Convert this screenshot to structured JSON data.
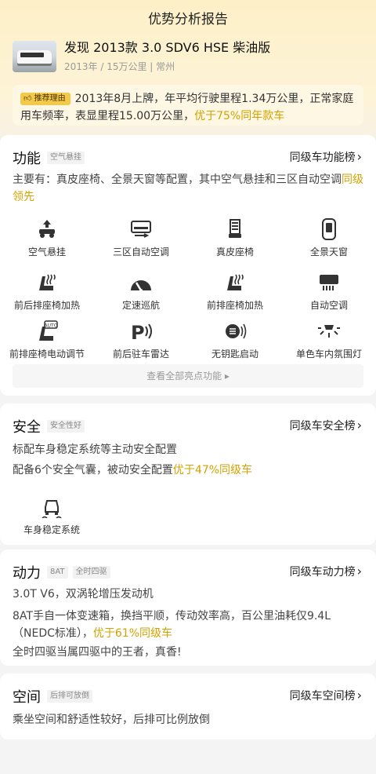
{
  "page": {
    "title": "优势分析报告"
  },
  "car": {
    "name": "发现 2013款 3.0 SDV6 HSE 柴油版",
    "meta": "2013年 / 15万公里 | 常州"
  },
  "reason": {
    "tag": "推荐理由",
    "text": "2013年8月上牌，年平均行驶里程1.34万公里，正常家庭用车频率，表显里程15.00万公里，",
    "highlight": "优于75%同年款车"
  },
  "function": {
    "title": "功能",
    "chip": "空气悬挂",
    "rank_label": "同级车功能榜",
    "desc": "主要有：真皮座椅、全景天窗等配置，其中空气悬挂和三区自动空调",
    "desc_highlight": "同级领先",
    "features": [
      {
        "icon": "air-suspension-icon",
        "label": "空气悬挂"
      },
      {
        "icon": "climate-control-icon",
        "label": "三区自动空调"
      },
      {
        "icon": "leather-seat-icon",
        "label": "真皮座椅"
      },
      {
        "icon": "panoramic-roof-icon",
        "label": "全景天窗"
      },
      {
        "icon": "seat-heating-icon",
        "label": "前后排座椅加热"
      },
      {
        "icon": "cruise-control-icon",
        "label": "定速巡航"
      },
      {
        "icon": "seat-heating-icon",
        "label": "前排座椅加热"
      },
      {
        "icon": "auto-ac-icon",
        "label": "自动空调"
      },
      {
        "icon": "power-seat-icon",
        "label": "前排座椅电动调节"
      },
      {
        "icon": "parking-radar-icon",
        "label": "前后驻车雷达"
      },
      {
        "icon": "keyless-start-icon",
        "label": "无钥匙启动"
      },
      {
        "icon": "ambient-light-icon",
        "label": "单色车内氛围灯"
      }
    ],
    "more_label": "查看全部亮点功能 ▸",
    "more_icon_glyph": "▸"
  },
  "safety": {
    "title": "安全",
    "chip": "安全性好",
    "rank_label": "同级车安全榜",
    "line1": "标配车身稳定系统等主动安全配置",
    "line2": "配备6个安全气囊，被动安全配置",
    "line2_highlight": "优于47%同级车",
    "feature": {
      "icon": "stability-control-icon",
      "label": "车身稳定系统"
    }
  },
  "power": {
    "title": "动力",
    "chips": [
      "8AT",
      "全时四驱"
    ],
    "rank_label": "同级车动力榜",
    "line1": "3.0T V6，双涡轮增压发动机",
    "line2": "8AT手自一体变速箱，换挡平顺，传动效率高，百公里油耗仅9.4L（NEDC标准），",
    "line2_highlight": "优于61%同级车",
    "line3": "全时四驱当属四驱中的王者，真香!"
  },
  "space": {
    "title": "空间",
    "chip": "后排可放倒",
    "rank_label": "同级车空间榜",
    "line1": "乘坐空间和舒适性较好，后排可比例放倒"
  },
  "colors": {
    "accent": "#d3a200",
    "tag": "#f3c94b",
    "hero": "#fdf0c8"
  }
}
